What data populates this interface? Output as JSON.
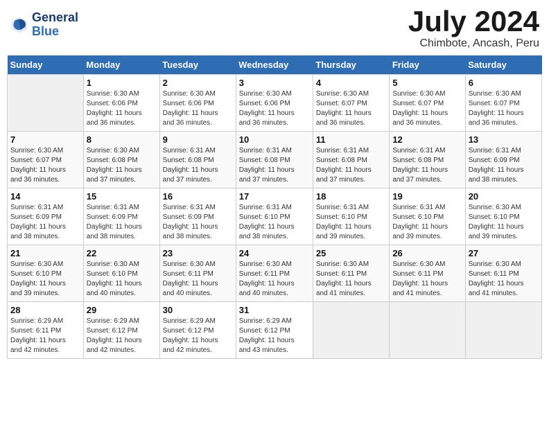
{
  "header": {
    "logo_line1": "General",
    "logo_line2": "Blue",
    "month": "July 2024",
    "location": "Chimbote, Ancash, Peru"
  },
  "days_of_week": [
    "Sunday",
    "Monday",
    "Tuesday",
    "Wednesday",
    "Thursday",
    "Friday",
    "Saturday"
  ],
  "weeks": [
    [
      {
        "day": "",
        "info": ""
      },
      {
        "day": "1",
        "info": "Sunrise: 6:30 AM\nSunset: 6:06 PM\nDaylight: 11 hours\nand 36 minutes."
      },
      {
        "day": "2",
        "info": "Sunrise: 6:30 AM\nSunset: 6:06 PM\nDaylight: 11 hours\nand 36 minutes."
      },
      {
        "day": "3",
        "info": "Sunrise: 6:30 AM\nSunset: 6:06 PM\nDaylight: 11 hours\nand 36 minutes."
      },
      {
        "day": "4",
        "info": "Sunrise: 6:30 AM\nSunset: 6:07 PM\nDaylight: 11 hours\nand 36 minutes."
      },
      {
        "day": "5",
        "info": "Sunrise: 6:30 AM\nSunset: 6:07 PM\nDaylight: 11 hours\nand 36 minutes."
      },
      {
        "day": "6",
        "info": "Sunrise: 6:30 AM\nSunset: 6:07 PM\nDaylight: 11 hours\nand 36 minutes."
      }
    ],
    [
      {
        "day": "7",
        "info": "Sunrise: 6:30 AM\nSunset: 6:07 PM\nDaylight: 11 hours\nand 36 minutes."
      },
      {
        "day": "8",
        "info": "Sunrise: 6:30 AM\nSunset: 6:08 PM\nDaylight: 11 hours\nand 37 minutes."
      },
      {
        "day": "9",
        "info": "Sunrise: 6:31 AM\nSunset: 6:08 PM\nDaylight: 11 hours\nand 37 minutes."
      },
      {
        "day": "10",
        "info": "Sunrise: 6:31 AM\nSunset: 6:08 PM\nDaylight: 11 hours\nand 37 minutes."
      },
      {
        "day": "11",
        "info": "Sunrise: 6:31 AM\nSunset: 6:08 PM\nDaylight: 11 hours\nand 37 minutes."
      },
      {
        "day": "12",
        "info": "Sunrise: 6:31 AM\nSunset: 6:08 PM\nDaylight: 11 hours\nand 37 minutes."
      },
      {
        "day": "13",
        "info": "Sunrise: 6:31 AM\nSunset: 6:09 PM\nDaylight: 11 hours\nand 38 minutes."
      }
    ],
    [
      {
        "day": "14",
        "info": "Sunrise: 6:31 AM\nSunset: 6:09 PM\nDaylight: 11 hours\nand 38 minutes."
      },
      {
        "day": "15",
        "info": "Sunrise: 6:31 AM\nSunset: 6:09 PM\nDaylight: 11 hours\nand 38 minutes."
      },
      {
        "day": "16",
        "info": "Sunrise: 6:31 AM\nSunset: 6:09 PM\nDaylight: 11 hours\nand 38 minutes."
      },
      {
        "day": "17",
        "info": "Sunrise: 6:31 AM\nSunset: 6:10 PM\nDaylight: 11 hours\nand 38 minutes."
      },
      {
        "day": "18",
        "info": "Sunrise: 6:31 AM\nSunset: 6:10 PM\nDaylight: 11 hours\nand 39 minutes."
      },
      {
        "day": "19",
        "info": "Sunrise: 6:31 AM\nSunset: 6:10 PM\nDaylight: 11 hours\nand 39 minutes."
      },
      {
        "day": "20",
        "info": "Sunrise: 6:30 AM\nSunset: 6:10 PM\nDaylight: 11 hours\nand 39 minutes."
      }
    ],
    [
      {
        "day": "21",
        "info": "Sunrise: 6:30 AM\nSunset: 6:10 PM\nDaylight: 11 hours\nand 39 minutes."
      },
      {
        "day": "22",
        "info": "Sunrise: 6:30 AM\nSunset: 6:10 PM\nDaylight: 11 hours\nand 40 minutes."
      },
      {
        "day": "23",
        "info": "Sunrise: 6:30 AM\nSunset: 6:11 PM\nDaylight: 11 hours\nand 40 minutes."
      },
      {
        "day": "24",
        "info": "Sunrise: 6:30 AM\nSunset: 6:11 PM\nDaylight: 11 hours\nand 40 minutes."
      },
      {
        "day": "25",
        "info": "Sunrise: 6:30 AM\nSunset: 6:11 PM\nDaylight: 11 hours\nand 41 minutes."
      },
      {
        "day": "26",
        "info": "Sunrise: 6:30 AM\nSunset: 6:11 PM\nDaylight: 11 hours\nand 41 minutes."
      },
      {
        "day": "27",
        "info": "Sunrise: 6:30 AM\nSunset: 6:11 PM\nDaylight: 11 hours\nand 41 minutes."
      }
    ],
    [
      {
        "day": "28",
        "info": "Sunrise: 6:29 AM\nSunset: 6:11 PM\nDaylight: 11 hours\nand 42 minutes."
      },
      {
        "day": "29",
        "info": "Sunrise: 6:29 AM\nSunset: 6:12 PM\nDaylight: 11 hours\nand 42 minutes."
      },
      {
        "day": "30",
        "info": "Sunrise: 6:29 AM\nSunset: 6:12 PM\nDaylight: 11 hours\nand 42 minutes."
      },
      {
        "day": "31",
        "info": "Sunrise: 6:29 AM\nSunset: 6:12 PM\nDaylight: 11 hours\nand 43 minutes."
      },
      {
        "day": "",
        "info": ""
      },
      {
        "day": "",
        "info": ""
      },
      {
        "day": "",
        "info": ""
      }
    ]
  ]
}
